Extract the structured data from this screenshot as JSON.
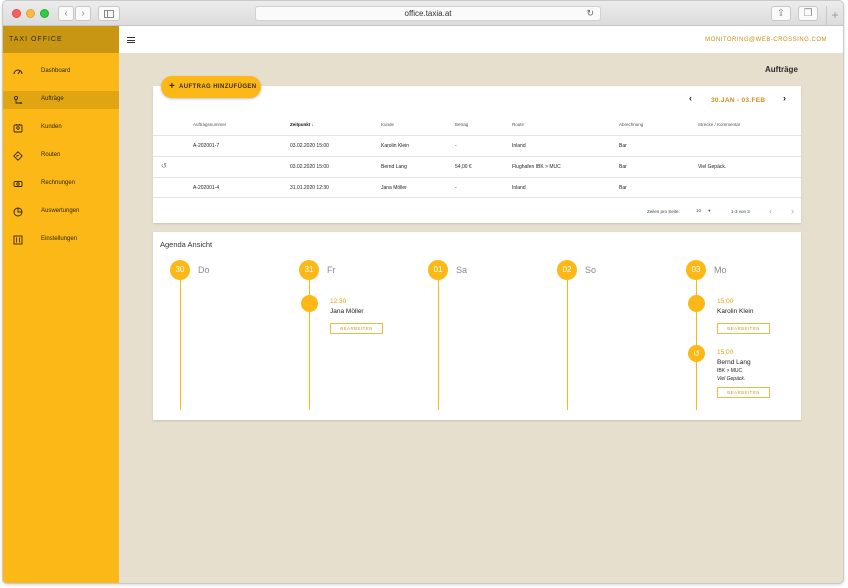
{
  "browser": {
    "url": "office.taxia.at"
  },
  "sidebar": {
    "brand": "TAXI OFFICE",
    "items": [
      {
        "label": "Dashboard",
        "icon": "speedometer-icon"
      },
      {
        "label": "Aufträge",
        "icon": "route-pin-icon",
        "active": true
      },
      {
        "label": "Kunden",
        "icon": "customers-icon"
      },
      {
        "label": "Routen",
        "icon": "road-sign-icon"
      },
      {
        "label": "Rechnungen",
        "icon": "invoice-icon"
      },
      {
        "label": "Auswertungen",
        "icon": "pie-chart-icon"
      },
      {
        "label": "Einstellungen",
        "icon": "sliders-icon"
      }
    ]
  },
  "topbar": {
    "email": "MONITORING@WEB-CROSSING.COM"
  },
  "page": {
    "title": "Aufträge",
    "add_label": "AUFTRAG HINZUFÜGEN",
    "date_range": "30.JAN - 03.FEB"
  },
  "table": {
    "headers": [
      "Auftragsnummer",
      "Zeitpunkt",
      "Kunde",
      "Betrag",
      "Route",
      "Abrechnung",
      "Strecke / Kommentar"
    ],
    "rows": [
      {
        "nummer": "A-202001-7",
        "zeitpunkt": "03.02.2020 15:00",
        "kunde": "Karolin Klein",
        "betrag": "-",
        "route": "Inland",
        "abrechnung": "Bar",
        "kommentar": "",
        "recurring": false
      },
      {
        "nummer": "",
        "zeitpunkt": "03.02.2020 15:00",
        "kunde": "Bernd Lang",
        "betrag": "54,00 €",
        "route": "Flughafen IBK > MUC",
        "abrechnung": "Bar",
        "kommentar": "Viel Gepäck.",
        "recurring": true
      },
      {
        "nummer": "A-202001-4",
        "zeitpunkt": "31.01.2020 12:30",
        "kunde": "Jana Möller",
        "betrag": "-",
        "route": "Inland",
        "abrechnung": "Bar",
        "kommentar": "",
        "recurring": false
      }
    ],
    "footer": {
      "rows_per_page_label": "Zeilen pro Seite:",
      "rows_per_page": "10",
      "range": "1-3 von 3"
    }
  },
  "agenda": {
    "title": "Agenda Ansicht",
    "edit_label": "BEARBEITEN",
    "days": [
      {
        "num": "30",
        "name": "Do",
        "events": []
      },
      {
        "num": "31",
        "name": "Fr",
        "events": [
          {
            "time": "12:30",
            "name": "Jana Möller"
          }
        ]
      },
      {
        "num": "01",
        "name": "Sa",
        "events": []
      },
      {
        "num": "02",
        "name": "So",
        "events": []
      },
      {
        "num": "03",
        "name": "Mo",
        "events": [
          {
            "time": "15:00",
            "name": "Karolin Klein"
          },
          {
            "time": "15:00",
            "name": "Bernd Lang",
            "route": "IBK > MUC",
            "note": "Viel Gepäck.",
            "recurring": true
          }
        ]
      }
    ]
  },
  "colors": {
    "accent": "#fbb816",
    "accent_dark": "#c99614",
    "background": "#e6dfcd"
  }
}
